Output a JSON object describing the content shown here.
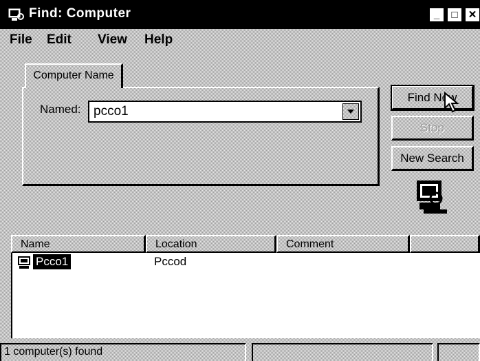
{
  "window": {
    "title": "Find: Computer",
    "minimize_label": "_",
    "maximize_label": "□",
    "close_label": "✕"
  },
  "menu": {
    "items": [
      {
        "label": "File"
      },
      {
        "label": "Edit"
      },
      {
        "label": "View"
      },
      {
        "label": "Help"
      }
    ]
  },
  "tab": {
    "label": "Computer Name"
  },
  "form": {
    "named_label": "Named:",
    "named_value": "pcco1"
  },
  "buttons": {
    "find_now": "Find Now",
    "stop": "Stop",
    "new_search": "New Search"
  },
  "results": {
    "columns": [
      "Name",
      "Location",
      "Comment"
    ],
    "rows": [
      {
        "name": "Pcco1",
        "location": "Pccod",
        "comment": ""
      }
    ]
  },
  "status": {
    "text": "1 computer(s) found"
  },
  "icons": {
    "title": "find-computer-icon",
    "search_animation": "computer-search-icon",
    "row": "computer-icon",
    "cursor": "mouse-pointer-icon"
  }
}
